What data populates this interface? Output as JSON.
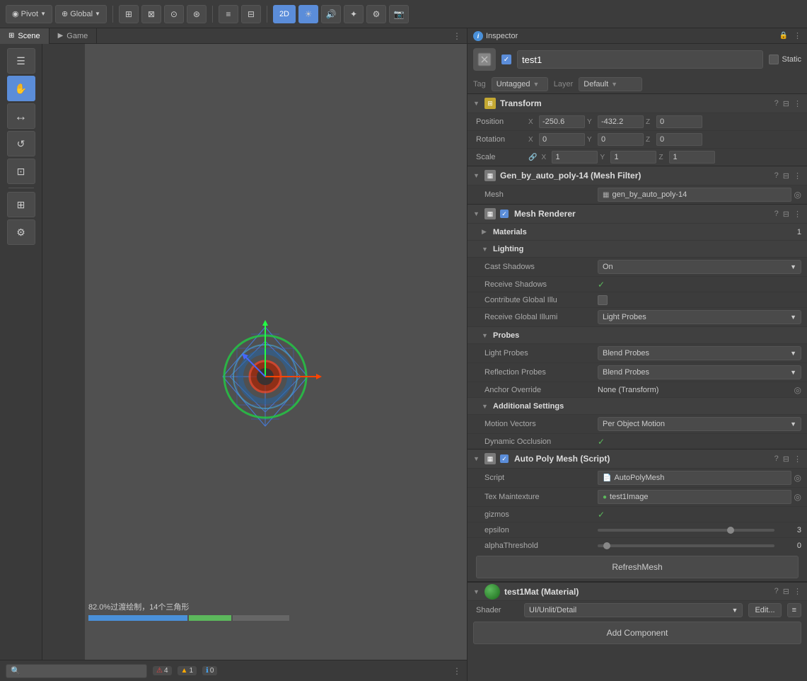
{
  "tabs": {
    "scene_label": "Scene",
    "game_label": "Game",
    "scene_icon": "⊞",
    "game_icon": "🎮"
  },
  "toolbar": {
    "pivot_label": "Pivot",
    "global_label": "Global",
    "tools": [
      "⊞",
      "⊠",
      "⊙",
      "⊛",
      "≡"
    ],
    "mode_2d": "2D",
    "pivot_icon": "◉",
    "global_icon": "⊕"
  },
  "left_tools": {
    "buttons": [
      "☰",
      "✋",
      "⟲",
      "↔",
      "⊕",
      "⊞",
      "⚙"
    ]
  },
  "scene_view": {
    "overdraw_text": "82.0%过渡绘制，14个三角形"
  },
  "inspector": {
    "title": "Inspector",
    "info_icon": "i",
    "options_icon": "⋮",
    "lock_icon": "🔒"
  },
  "object": {
    "name": "test1",
    "tag": "Untagged",
    "layer": "Default",
    "static_label": "Static"
  },
  "transform": {
    "title": "Transform",
    "position_label": "Position",
    "rotation_label": "Rotation",
    "scale_label": "Scale",
    "position": {
      "x": "-250.6",
      "y": "-432.2",
      "z": "0"
    },
    "rotation": {
      "x": "0",
      "y": "0",
      "z": "0"
    },
    "scale": {
      "x": "1",
      "y": "1",
      "z": "1"
    },
    "x_label": "X",
    "y_label": "Y",
    "z_label": "Z"
  },
  "mesh_filter": {
    "title": "Gen_by_auto_poly-14 (Mesh Filter)",
    "mesh_label": "Mesh",
    "mesh_value": "gen_by_auto_poly-14"
  },
  "mesh_renderer": {
    "title": "Mesh Renderer",
    "materials_label": "Materials",
    "materials_count": "1",
    "lighting_label": "Lighting",
    "cast_shadows_label": "Cast Shadows",
    "cast_shadows_value": "On",
    "receive_shadows_label": "Receive Shadows",
    "contribute_global_label": "Contribute Global Illu",
    "receive_global_label": "Receive Global Illumi",
    "receive_global_value": "Light Probes",
    "probes_label": "Probes",
    "light_probes_label": "Light Probes",
    "light_probes_value": "Blend Probes",
    "reflection_probes_label": "Reflection Probes",
    "reflection_probes_value": "Blend Probes",
    "anchor_override_label": "Anchor Override",
    "anchor_override_value": "None (Transform)",
    "additional_settings_label": "Additional Settings",
    "motion_vectors_label": "Motion Vectors",
    "motion_vectors_value": "Per Object Motion",
    "dynamic_occlusion_label": "Dynamic Occlusion"
  },
  "auto_poly": {
    "title": "Auto Poly Mesh (Script)",
    "script_label": "Script",
    "script_value": "AutoPolyMesh",
    "tex_label": "Tex Maintexture",
    "tex_value": "test1Image",
    "gizmos_label": "gizmos",
    "epsilon_label": "epsilon",
    "epsilon_value": "3",
    "alpha_label": "alphaThreshold",
    "alpha_value": "0",
    "refresh_btn": "RefreshMesh",
    "epsilon_percent": 0.75,
    "alpha_percent": 0.05
  },
  "material": {
    "title": "test1Mat (Material)",
    "shader_label": "Shader",
    "shader_value": "UI/Unlit/Detail",
    "edit_label": "Edit...",
    "expand_icon": "≡"
  },
  "add_component": {
    "label": "Add Component"
  },
  "bottom_bar": {
    "search_placeholder": "🔍",
    "error_count": "4",
    "warn_count": "1",
    "info_count": "0",
    "options_icon": "⋮"
  }
}
